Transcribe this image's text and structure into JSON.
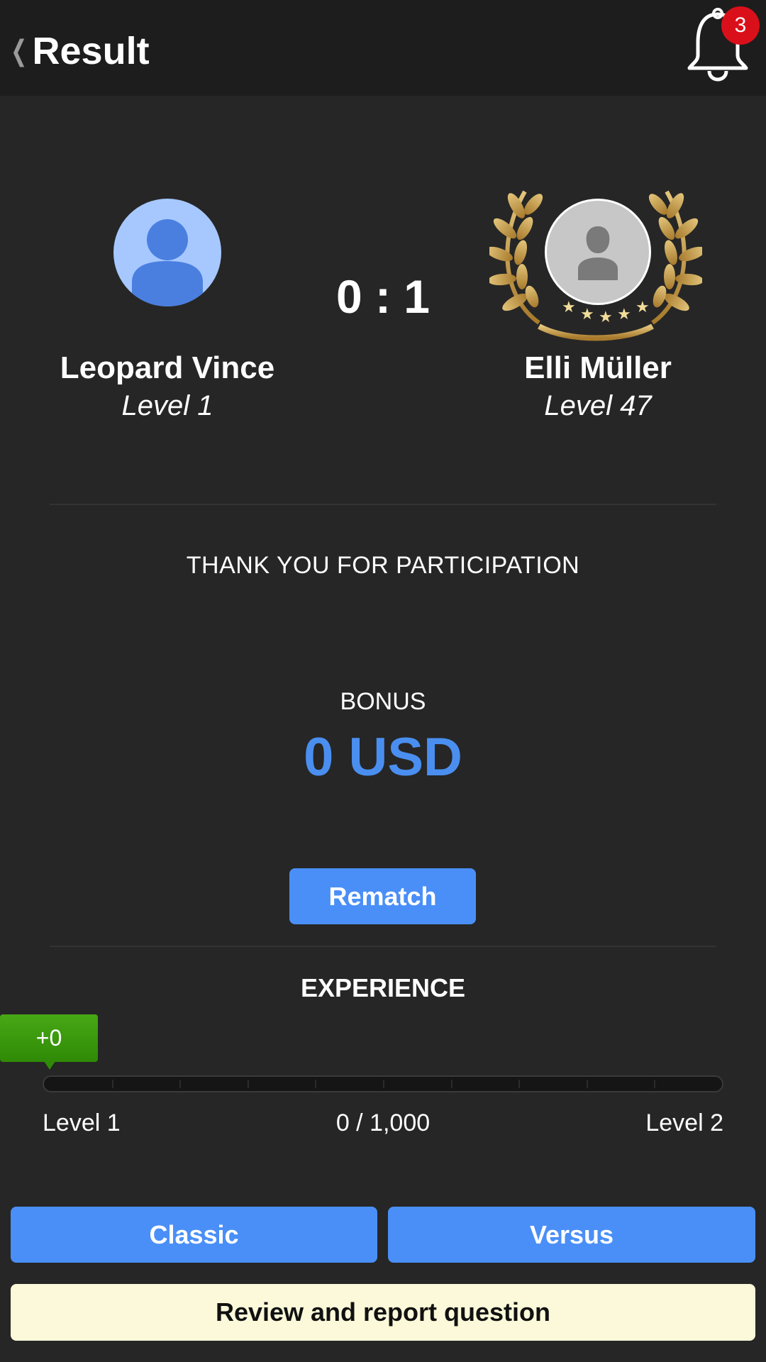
{
  "header": {
    "back_icon": "chevron-left-icon",
    "title": "Result",
    "notification_icon": "bell-icon",
    "notification_count": "3"
  },
  "match": {
    "player": {
      "name": "Leopard Vince",
      "level": "Level 1",
      "avatar_icon": "person-icon"
    },
    "opponent": {
      "name": "Elli Müller",
      "level": "Level 47",
      "avatar_icon": "person-icon",
      "winner_icon": "laurel-wreath-icon"
    },
    "score": "0 : 1"
  },
  "message": "THANK YOU FOR PARTICIPATION",
  "bonus": {
    "label": "BONUS",
    "value": "0 USD"
  },
  "rematch_label": "Rematch",
  "experience": {
    "title": "EXPERIENCE",
    "gain": "+0",
    "progress_fraction": 0,
    "start_label": "Level 1",
    "progress_text": "0 / 1,000",
    "end_label": "Level 2"
  },
  "actions": {
    "classic": "Classic",
    "versus": "Versus",
    "review": "Review and report question"
  },
  "colors": {
    "background": "#262626",
    "header": "#1d1d1d",
    "accent_blue": "#4a8ff7",
    "bonus_blue": "#4a8ff0",
    "xp_green": "#47a815",
    "badge_red": "#d9101a",
    "review_bg": "#fbf9d9",
    "laurel_gold": "#c9a14a"
  }
}
